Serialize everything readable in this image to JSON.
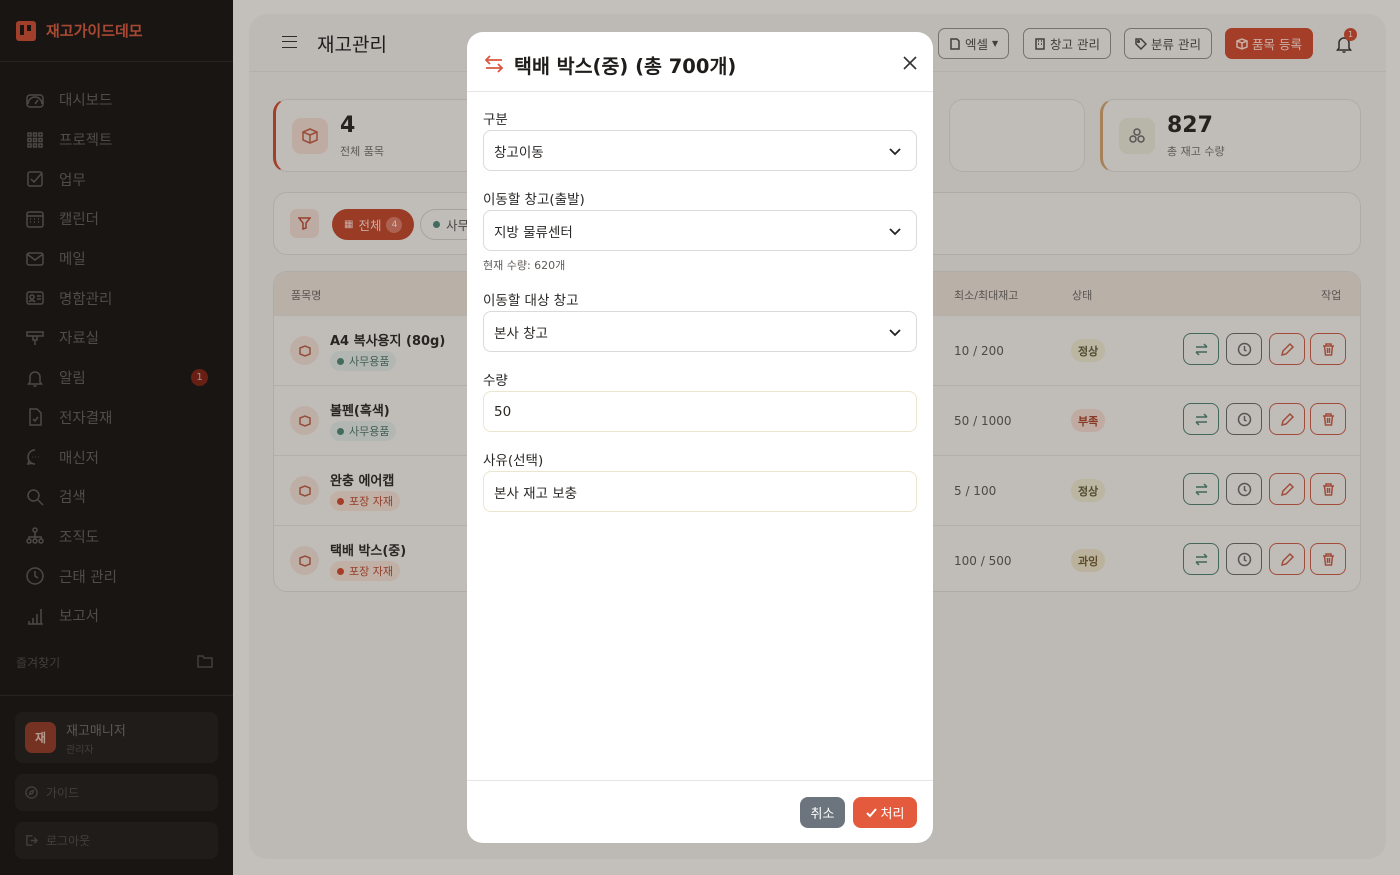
{
  "brand": {
    "name": "재고가이드데모"
  },
  "sidebar": {
    "items": [
      {
        "label": "대시보드",
        "icon": "dashboard-icon"
      },
      {
        "label": "프로젝트",
        "icon": "grid-icon"
      },
      {
        "label": "업무",
        "icon": "checkbox-icon"
      },
      {
        "label": "캘린더",
        "icon": "calendar-icon"
      },
      {
        "label": "메일",
        "icon": "mail-icon"
      },
      {
        "label": "명함관리",
        "icon": "id-card-icon"
      },
      {
        "label": "자료실",
        "icon": "archive-icon"
      },
      {
        "label": "알림",
        "icon": "bell-icon",
        "badge": "1"
      },
      {
        "label": "전자결재",
        "icon": "document-check-icon"
      },
      {
        "label": "매신저",
        "icon": "chat-icon"
      },
      {
        "label": "검색",
        "icon": "search-icon"
      },
      {
        "label": "조직도",
        "icon": "org-chart-icon"
      },
      {
        "label": "근태 관리",
        "icon": "clock-icon"
      },
      {
        "label": "보고서",
        "icon": "bar-chart-icon"
      }
    ],
    "favorites_label": "즐겨찾기",
    "user": {
      "avatar": "재",
      "name": "재고매니저",
      "role": "관리자"
    },
    "guide_label": "가이드",
    "logout_label": "로그아웃"
  },
  "header": {
    "title": "재고관리",
    "excel_label": "엑셀",
    "warehouse_label": "창고 관리",
    "category_label": "분류 관리",
    "register_label": "품목 등록",
    "notification_count": "1"
  },
  "stats": [
    {
      "value": "4",
      "label": "전체 품목"
    },
    {
      "value": "827",
      "label": "총 재고 수량"
    }
  ],
  "filters": {
    "all_label": "전체",
    "all_count": "4",
    "category_chip": "사무용품"
  },
  "table": {
    "headers": {
      "name": "품목명",
      "minmax": "최소/최대재고",
      "status": "상태",
      "actions": "작업"
    },
    "rows": [
      {
        "name": "A4 복사용지 (80g)",
        "category": "사무용품",
        "minmax": "10 / 200",
        "status": "정상"
      },
      {
        "name": "볼펜(흑색)",
        "category": "사무용품",
        "minmax": "50 / 1000",
        "status": "부족"
      },
      {
        "name": "완충 에어캡",
        "category": "포장 자재",
        "minmax": "5 / 100",
        "status": "정상"
      },
      {
        "name": "택배 박스(중)",
        "category": "포장 자재",
        "minmax": "100 / 500",
        "status": "과잉"
      }
    ]
  },
  "modal": {
    "title": "택배 박스(중) (총 700개)",
    "type_label": "구분",
    "type_value": "창고이동",
    "from_label": "이동할 창고(출발)",
    "from_value": "지방 물류센터",
    "from_hint": "현재 수량: 620개",
    "to_label": "이동할 대상 창고",
    "to_value": "본사 창고",
    "qty_label": "수량",
    "qty_value": "50",
    "reason_label": "사유(선택)",
    "reason_value": "본사 재고 보충",
    "cancel_label": "취소",
    "submit_label": "처리"
  },
  "colors": {
    "accent": "#e35a3d",
    "cancel": "#6c757d",
    "sidebar_bg": "#1a1715"
  }
}
